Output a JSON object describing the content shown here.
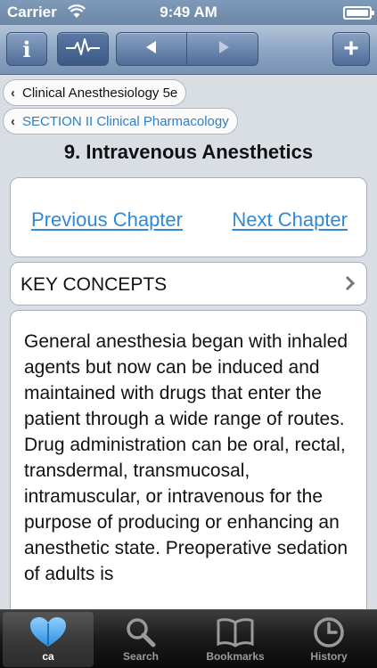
{
  "status_bar": {
    "carrier": "Carrier",
    "time": "9:49 AM"
  },
  "navbar": {
    "info_label": "i",
    "add_label": "+"
  },
  "breadcrumbs": [
    {
      "label": "Clinical Anesthesiology 5e"
    },
    {
      "label": "SECTION II Clinical Pharmacology"
    }
  ],
  "chapter": {
    "title": "9. Intravenous Anesthetics"
  },
  "chapter_nav": {
    "previous_label": "Previous Chapter",
    "next_label": "Next Chapter"
  },
  "key_concepts": {
    "label": "KEY CONCEPTS"
  },
  "content": {
    "body": "General anesthesia began with inhaled agents but now can be induced and maintained with drugs that enter the patient through a wide range of routes. Drug administration can be oral, rectal, transdermal, transmucosal, intramuscular, or intravenous for the purpose of producing or enhancing an anesthetic state. Preoperative sedation of adults is"
  },
  "tabs": [
    {
      "label": "ca",
      "icon": "heart-book-icon",
      "active": true
    },
    {
      "label": "Search",
      "icon": "search-icon",
      "active": false
    },
    {
      "label": "Bookmarks",
      "icon": "book-icon",
      "active": false
    },
    {
      "label": "History",
      "icon": "clock-icon",
      "active": false
    }
  ],
  "colors": {
    "link": "#2f89d6",
    "breadcrumb_section": "#2f7fc1",
    "navbar": "#7892b4",
    "background": "#d9dde4"
  }
}
